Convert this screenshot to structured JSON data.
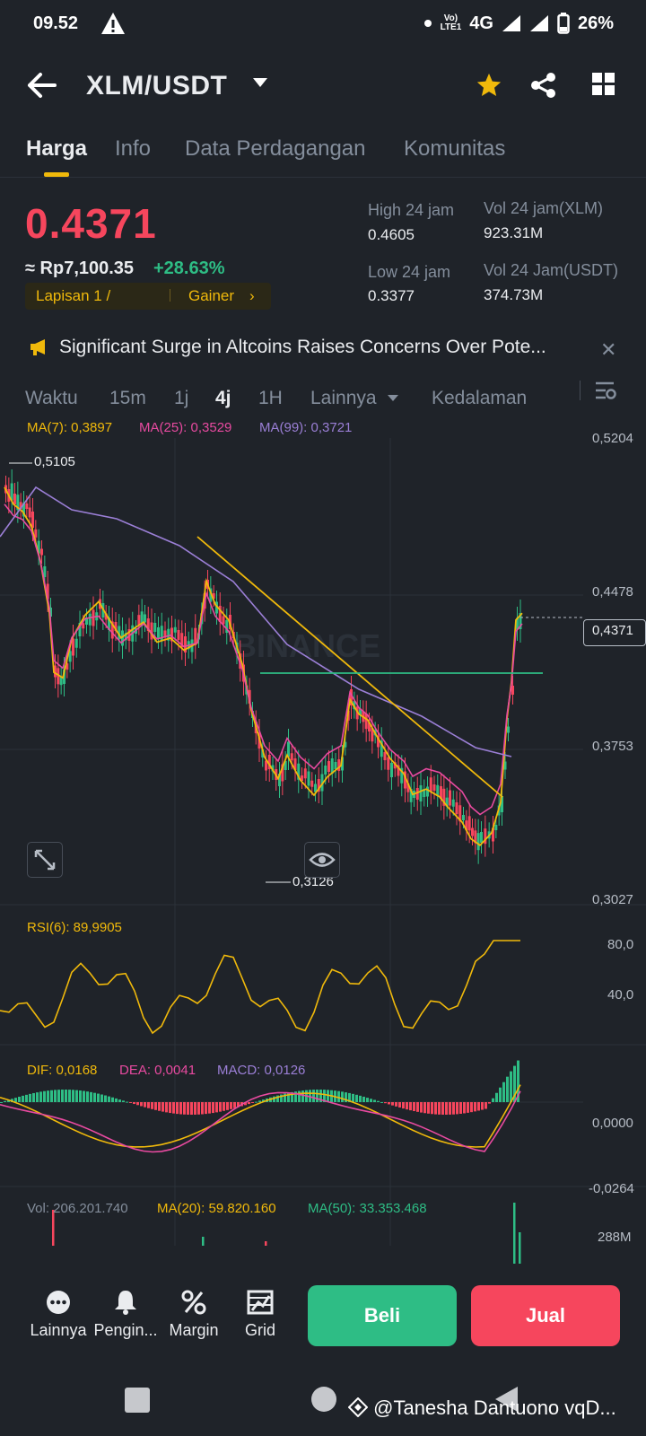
{
  "status_bar": {
    "time": "09.52",
    "volte_line1": "Vo)",
    "volte_line2": "LTE1",
    "network": "4G",
    "battery": "26%"
  },
  "header": {
    "pair": "XLM/USDT"
  },
  "tabs": [
    {
      "label": "Harga",
      "active": true
    },
    {
      "label": "Info",
      "active": false
    },
    {
      "label": "Data Perdagangan",
      "active": false
    },
    {
      "label": "Komunitas",
      "active": false
    }
  ],
  "ticker": {
    "last_price": "0.4371",
    "idr_price": "≈ Rp7,100.35",
    "change_pct": "+28.63%",
    "tag_layer": "Lapisan 1 /",
    "tag_gainer": "Gainer",
    "high_label": "High 24 jam",
    "high_value": "0.4605",
    "low_label": "Low 24 jam",
    "low_value": "0.3377",
    "vol_xlm_label": "Vol 24 jam(XLM)",
    "vol_xlm_value": "923.31M",
    "vol_usdt_label": "Vol 24 Jam(USDT)",
    "vol_usdt_value": "374.73M"
  },
  "news": {
    "headline": "Significant Surge in Altcoins Raises Concerns Over Pote..."
  },
  "interval_bar": {
    "time_label": "Waktu",
    "intervals": [
      "15m",
      "1j",
      "4j",
      "1H"
    ],
    "active_interval": "4j",
    "more": "Lainnya",
    "depth": "Kedalaman"
  },
  "chart": {
    "watermark": "BINANCE",
    "ma_legend": {
      "ma7": "MA(7): 0,3897",
      "ma25": "MA(25): 0,3529",
      "ma99": "MA(99): 0,3721"
    },
    "price_axis": [
      "0,5204",
      "0,4478",
      "0,3753",
      "0,3027"
    ],
    "current_price_tag": "0,4371",
    "high_marker": "0,5105",
    "low_marker": "0,3126",
    "rsi_legend": "RSI(6): 89,9905",
    "rsi_axis": [
      "80,0",
      "40,0"
    ],
    "macd_legend": {
      "dif": "DIF: 0,0168",
      "dea": "DEA: 0,0041",
      "macd": "MACD: 0,0126"
    },
    "macd_axis": [
      "0,0000",
      "-0,0264"
    ],
    "vol_legend": {
      "vol": "Vol: 206.201.740",
      "ma20": "MA(20): 59.820.160",
      "ma50": "MA(50): 33.353.468"
    },
    "vol_axis": "288M",
    "colors": {
      "up": "#2ebd85",
      "down": "#f6465d",
      "ma7": "#f0b90b",
      "ma25": "#e84aa0",
      "ma99": "#9b7fd6"
    }
  },
  "bottom_actions": [
    {
      "label": "Lainnya",
      "icon": "more-dots-icon"
    },
    {
      "label": "Pengin...",
      "icon": "bell-icon"
    },
    {
      "label": "Margin",
      "icon": "percent-icon"
    },
    {
      "label": "Grid",
      "icon": "grid-bot-icon"
    }
  ],
  "buttons": {
    "buy": "Beli",
    "sell": "Jual"
  },
  "watermark_text": "@Tanesha Dantuono vqD..."
}
